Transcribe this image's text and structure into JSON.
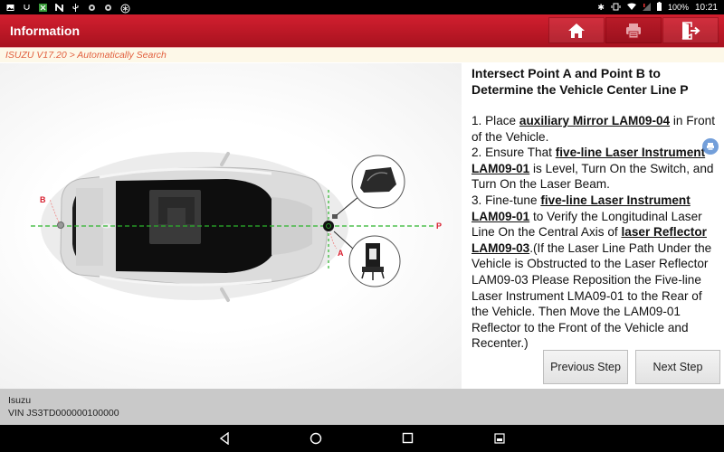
{
  "status_bar": {
    "left_icons": [
      "image-icon",
      "usb-debug-icon",
      "app-icon",
      "n-icon",
      "usb-icon",
      "shield-icon",
      "shield-icon",
      "settings-icon"
    ],
    "right_icons": [
      "bluetooth-icon",
      "vibrate-icon",
      "wifi-icon",
      "signal-icon",
      "battery-icon"
    ],
    "battery": "100%",
    "time": "10:21"
  },
  "app_bar": {
    "title": "Information",
    "buttons": [
      {
        "name": "home",
        "icon": "home-icon"
      },
      {
        "name": "print",
        "icon": "printer-icon"
      },
      {
        "name": "exit",
        "icon": "exit-icon"
      }
    ]
  },
  "breadcrumb": "ISUZU V17.20 > Automatically Search",
  "illustration": {
    "label_a": "A",
    "label_b": "B",
    "label_p": "P"
  },
  "content": {
    "title": "Intersect Point A and Point B to Determine the Vehicle Center Line P",
    "step1_pre": "1. Place ",
    "step1_link": "auxiliary Mirror LAM09-04",
    "step1_post": " in Front of the Vehicle.",
    "step2_pre": "2. Ensure That ",
    "step2_link": "five-line Laser Instrument LAM09-01",
    "step2_post": " is Level, Turn On the Switch, and Turn On the Laser Beam.",
    "step3_pre": "3. Fine-tune ",
    "step3_link1": "five-line Laser Instrument LAM09-01",
    "step3_mid": " to Verify the Longitudinal Laser Line On the Central Axis of ",
    "step3_link2": "laser Reflector LAM09-03",
    "step3_post": ".(If the Laser Line Path Under the Vehicle is Obstructed to the Laser Reflector LAM09-03 Please Reposition the Five-line Laser Instrument LMA09-01 to the Rear of the Vehicle. Then Move the LAM09-01 Reflector to the Front of the Vehicle and Recenter.)"
  },
  "buttons": {
    "previous": "Previous Step",
    "next": "Next Step"
  },
  "footer": {
    "make": "Isuzu",
    "vin": "VIN JS3TD000000100000"
  },
  "colors": {
    "brand_red": "#c41a28",
    "breadcrumb_text": "#e2603f",
    "laser_green": "#2bb52b",
    "label_red": "#d81e2e"
  }
}
